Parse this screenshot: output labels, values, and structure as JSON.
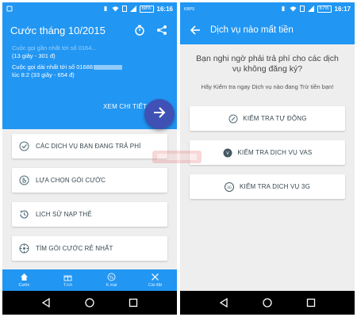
{
  "left_screen": {
    "status": {
      "signal_text": "",
      "battery": "68%",
      "time": "16:16"
    },
    "title": "Cước tháng 10/2015",
    "calls": {
      "line1_faded": "Cuộc gọi gần nhất tới số 0164...",
      "line2": "(13 giây - 301 đ)",
      "line3_prefix": "Cuộc gọi dài nhất  tới số 01688",
      "line4": "lúc 8:2 (33 giây - 654 đ)"
    },
    "see_detail": "XEM CHI TIẾT",
    "cards": [
      {
        "label": "CÁC DỊCH VỤ BẠN ĐANG TRẢ PHÍ",
        "icon": "check-circle-icon"
      },
      {
        "label": "LỰA CHỌN GÓI CƯỚC",
        "icon": "hand-point-icon"
      },
      {
        "label": "LỊCH SỬ NẠP THẺ",
        "icon": "history-icon"
      },
      {
        "label": "TÌM GÓI CƯỚC RẺ NHẤT",
        "icon": "search-pack-icon"
      }
    ],
    "bottom_nav": [
      {
        "label": "Cước",
        "icon": "home-icon",
        "active": true
      },
      {
        "label": "T.ích",
        "icon": "gift-icon",
        "active": false
      },
      {
        "label": "K.mại",
        "icon": "promo-icon",
        "active": false
      },
      {
        "label": "Cài đặt",
        "icon": "tools-icon",
        "active": false
      }
    ]
  },
  "right_screen": {
    "status": {
      "carrier": "KBPS",
      "battery": "67%",
      "time": "16:17"
    },
    "title": "Dịch vụ nào mất tiền",
    "question": "Bạn nghi ngờ phải trả phí cho các dịch vụ không đăng ký?",
    "hint": "Hãy Kiểm tra ngay Dịch vụ nào đang Trừ tiền bạn!",
    "buttons": [
      {
        "label": "KIỂM TRA TỰ ĐỘNG",
        "icon": "auto-check-icon"
      },
      {
        "label": "KIỂM TRA DỊCH VỤ VAS",
        "icon": "vas-icon"
      },
      {
        "label": "KIỂM TRA DỊCH VỤ 3G",
        "icon": "3g-icon"
      }
    ]
  },
  "colors": {
    "primary": "#2196f3",
    "fab": "#3f51b5",
    "card_text": "#37474f",
    "background": "#eeeeee"
  }
}
